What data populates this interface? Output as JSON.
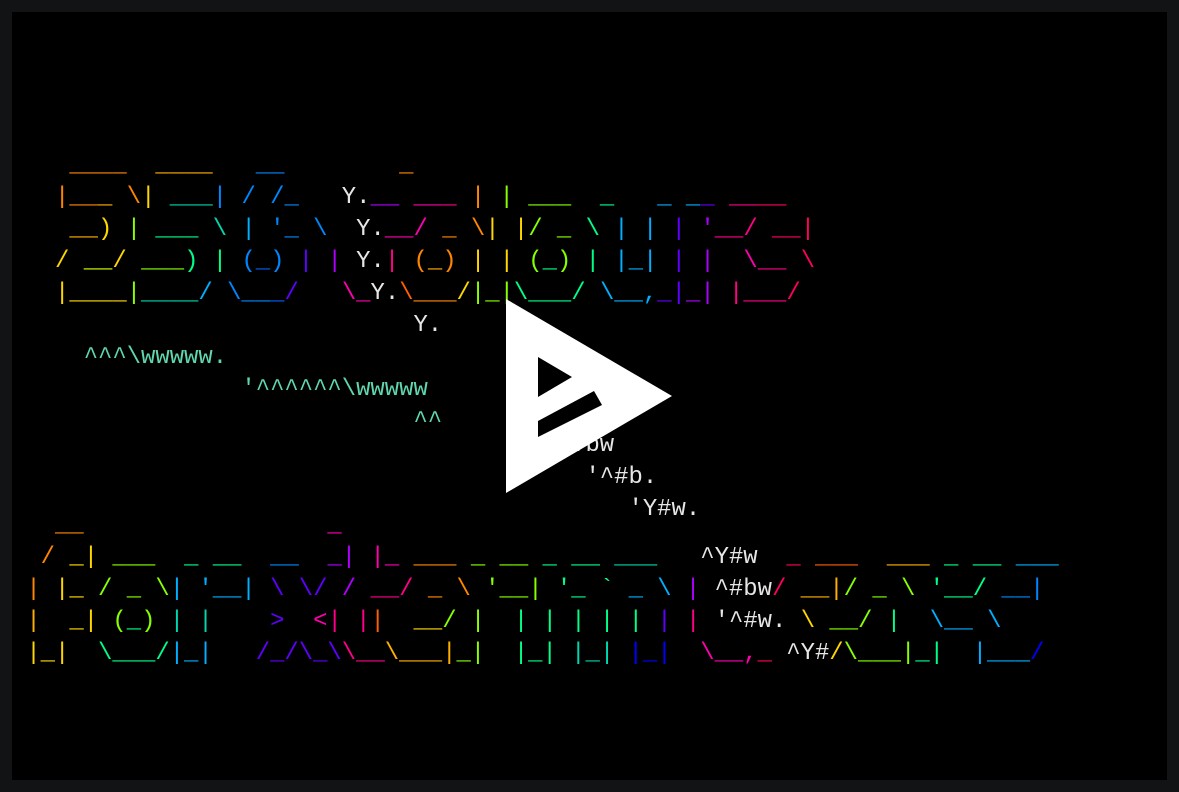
{
  "player": {
    "background": "#000000",
    "frame_color": "#121314",
    "play_button": {
      "icon": "play-icon",
      "label": "Play",
      "color": "#ffffff"
    }
  },
  "terminal": {
    "default_color": "#e6e6e6",
    "rows": [
      {
        "segs": [
          [
            "    ____",
            "#ff8700"
          ],
          [
            "  ",
            null
          ],
          [
            "____",
            "#ffaf00"
          ],
          [
            "   ",
            null
          ],
          [
            "__",
            "#0087ff"
          ],
          [
            "        ",
            null
          ],
          [
            "_",
            "#ff8700"
          ]
        ]
      },
      {
        "segs": [
          [
            "   |__",
            "#ff8700"
          ],
          [
            "_",
            "#ffaf00"
          ],
          [
            " \\",
            "#ff8700"
          ],
          [
            "| ",
            "#ffd700"
          ],
          [
            "___",
            "#00d7af"
          ],
          [
            "| / /_",
            "#0087ff"
          ],
          [
            "   Y.",
            "#e6e6e6"
          ],
          [
            "__",
            "#af00ff"
          ],
          [
            " __",
            "#ff00af"
          ],
          [
            "_",
            "#ff0087"
          ],
          [
            " | ",
            "#ff8700"
          ],
          [
            "| ___",
            "#87ff00"
          ],
          [
            "  _",
            "#00ff87"
          ],
          [
            "   _ _",
            "#00afff"
          ],
          [
            "_ ",
            "#5f00ff"
          ],
          [
            "__",
            "#ff0087"
          ],
          [
            "__",
            "#ff005f"
          ]
        ]
      },
      {
        "segs": [
          [
            "    __",
            "#ffaf00"
          ],
          [
            ") ",
            "#ffd700"
          ],
          [
            "| ",
            "#87ff00"
          ],
          [
            "___",
            "#00ff87"
          ],
          [
            " \\",
            "#00d7af"
          ],
          [
            " |",
            "#00afff"
          ],
          [
            " '_ \\",
            "#0087ff"
          ],
          [
            "  Y.",
            "#e6e6e6"
          ],
          [
            "__/ ",
            "#ff00af"
          ],
          [
            "_ \\",
            "#ff8700"
          ],
          [
            "| |",
            "#ffd700"
          ],
          [
            "/ _ ",
            "#87ff00"
          ],
          [
            "\\",
            "#00ff87"
          ],
          [
            " | |",
            "#00afff"
          ],
          [
            " |",
            "#5f00ff"
          ],
          [
            " '",
            "#af00ff"
          ],
          [
            "__/",
            "#ff0087"
          ],
          [
            " __",
            "#ff005f"
          ],
          [
            "|",
            "#ff005f"
          ]
        ]
      },
      {
        "segs": [
          [
            "   / ",
            "#ffd700"
          ],
          [
            "__",
            "#d7ff00"
          ],
          [
            "/ ",
            "#ffd700"
          ],
          [
            "___",
            "#87ff00"
          ],
          [
            ") | ",
            "#00ff87"
          ],
          [
            "(",
            "#0087ff"
          ],
          [
            "_",
            "#005fff"
          ],
          [
            ")",
            "#0087ff"
          ],
          [
            " | ",
            "#5f00ff"
          ],
          [
            "|",
            "#af00ff"
          ],
          [
            " Y.",
            "#e6e6e6"
          ],
          [
            "| ",
            "#ff0087"
          ],
          [
            "(",
            "#ff8700"
          ],
          [
            "_",
            "#ffaf00"
          ],
          [
            ")",
            "#ff8700"
          ],
          [
            " | | ",
            "#ffd700"
          ],
          [
            "(",
            "#87ff00"
          ],
          [
            "_",
            "#00ff87"
          ],
          [
            ")",
            "#87ff00"
          ],
          [
            " | ",
            "#00ff87"
          ],
          [
            "|_| ",
            "#00afff"
          ],
          [
            "| ",
            "#5f00ff"
          ],
          [
            "|",
            "#af00ff"
          ],
          [
            "  \\",
            "#ff00af"
          ],
          [
            "__",
            "#ff0087"
          ],
          [
            " \\",
            "#ff005f"
          ]
        ]
      },
      {
        "segs": [
          [
            "   |____",
            "#ffd700"
          ],
          [
            "|",
            "#87ff00"
          ],
          [
            "____",
            "#00d7af"
          ],
          [
            "/ ",
            "#00afff"
          ],
          [
            "\\__",
            "#0087ff"
          ],
          [
            "_",
            "#005fff"
          ],
          [
            "/   ",
            "#5f00ff"
          ],
          [
            "\\_",
            "#ff00af"
          ],
          [
            "Y.",
            "#e6e6e6"
          ],
          [
            "\\",
            "#ff5f00"
          ],
          [
            "___",
            "#ff8700"
          ],
          [
            "/",
            "#ffd700"
          ],
          [
            "|_|",
            "#87ff00"
          ],
          [
            "\\___/ ",
            "#00ff87"
          ],
          [
            "\\__,",
            "#00afff"
          ],
          [
            "_|",
            "#5f00ff"
          ],
          [
            "_|",
            "#af00ff"
          ],
          [
            " |___",
            "#ff0087"
          ],
          [
            "/",
            "#ff005f"
          ]
        ]
      },
      {
        "segs": [
          [
            "                            ",
            null
          ],
          [
            "Y.",
            "#e6e6e6"
          ]
        ]
      },
      {
        "segs": [
          [
            "     ",
            null
          ],
          [
            "^^^\\wwwww.",
            "#5fd7af"
          ]
        ]
      },
      {
        "segs": [
          [
            "                ",
            null
          ],
          [
            "'^^^^^^\\wwww",
            "#5fd7af"
          ],
          [
            "w",
            "#5fd7af"
          ]
        ]
      },
      {
        "segs": [
          [
            "                            ",
            null
          ],
          [
            "^^",
            "#5fd7af"
          ],
          [
            "      ",
            null
          ],
          [
            ".",
            "#e6e6e6"
          ]
        ]
      },
      {
        "segs": [
          [
            "                                      ",
            null
          ],
          [
            "^Ybw",
            "#e6e6e6"
          ]
        ]
      },
      {
        "segs": [
          [
            "                                        ",
            null
          ],
          [
            "'^#b.",
            "#e6e6e6"
          ]
        ]
      },
      {
        "segs": [
          [
            "                                           ",
            null
          ],
          [
            "'Y#w.",
            "#e6e6e6"
          ]
        ]
      },
      {
        "segs": [
          [
            "   __",
            "#ff8700"
          ],
          [
            "                 ",
            null
          ],
          [
            "_",
            "#ff00af"
          ]
        ]
      },
      {
        "segs": [
          [
            "  / ",
            "#ff8700"
          ],
          [
            "_|",
            "#ffd700"
          ],
          [
            " ___",
            "#87ff00"
          ],
          [
            "  _ __",
            "#00ff87"
          ],
          [
            "  __",
            "#0087ff"
          ],
          [
            "  _|",
            "#af00ff"
          ],
          [
            " |_",
            "#ff00af"
          ],
          [
            " ___",
            "#ff8700"
          ],
          [
            " _ __",
            "#87ff00"
          ],
          [
            " _ __",
            "#00ff87"
          ],
          [
            " ___",
            "#00d7af"
          ],
          [
            "   ",
            null
          ],
          [
            "^Y#w",
            "#e6e6e6"
          ],
          [
            "  _",
            "#ff005f"
          ],
          [
            " __",
            "#ff5f00"
          ],
          [
            "_",
            "#ff5f00"
          ],
          [
            "  ___",
            "#ffaf00"
          ],
          [
            " _ __",
            "#00ff87"
          ],
          [
            " ___",
            "#00afff"
          ]
        ]
      },
      {
        "segs": [
          [
            " | ",
            "#ff8700"
          ],
          [
            "|_",
            "#ffd700"
          ],
          [
            " / _ \\",
            "#87ff00"
          ],
          [
            "| '__|",
            "#00afff"
          ],
          [
            " \\ \\/",
            "#5f00ff"
          ],
          [
            " / ",
            "#af00ff"
          ],
          [
            "__/",
            "#ff0087"
          ],
          [
            " _ \\",
            "#ff8700"
          ],
          [
            " '__|",
            "#87ff00"
          ],
          [
            " '_ ` ",
            "#00ff87"
          ],
          [
            "_ \\",
            "#00afff"
          ],
          [
            " | ",
            "#af00ff"
          ],
          [
            "^#bw",
            "#e6e6e6"
          ],
          [
            "/",
            "#ff005f"
          ],
          [
            " __|",
            "#ffaf00"
          ],
          [
            "/ _ \\",
            "#87ff00"
          ],
          [
            " '__/",
            "#00ff87"
          ],
          [
            " __|",
            "#0087ff"
          ]
        ]
      },
      {
        "segs": [
          [
            " |  ",
            "#ffaf00"
          ],
          [
            "_|",
            "#ffd700"
          ],
          [
            " (",
            "#87ff00"
          ],
          [
            "_",
            "#00ff87"
          ],
          [
            ")",
            "#87ff00"
          ],
          [
            " | |",
            "#00d7af"
          ],
          [
            "    ",
            null
          ],
          [
            ">",
            "#5f00ff"
          ],
          [
            "  <",
            "#ff00af"
          ],
          [
            "| |",
            "#ff0087"
          ],
          [
            "|",
            "#ff5f00"
          ],
          [
            "  __",
            "#ffd700"
          ],
          [
            "/ |",
            "#87ff00"
          ],
          [
            "  | | | | |",
            "#00ff87"
          ],
          [
            " |",
            "#5f00ff"
          ],
          [
            " |",
            "#ff0087"
          ],
          [
            " '^#w.",
            "#e6e6e6"
          ],
          [
            " \\",
            "#ffd700"
          ],
          [
            " __/",
            "#87ff00"
          ],
          [
            " |  ",
            "#00ff87"
          ],
          [
            "\\__ \\",
            "#00afff"
          ]
        ]
      },
      {
        "segs": [
          [
            " |_|",
            "#ffd700"
          ],
          [
            "  \\___/",
            "#00ff87"
          ],
          [
            "|_|",
            "#00afff"
          ],
          [
            "   /_/\\_\\",
            "#5f00ff"
          ],
          [
            "\\__",
            "#ff0087"
          ],
          [
            "\\___|",
            "#ffaf00"
          ],
          [
            "_|",
            "#87ff00"
          ],
          [
            "  |_|",
            "#00ff87"
          ],
          [
            " |_|",
            "#00d7af"
          ],
          [
            " |_|",
            "#0000ff"
          ],
          [
            "  \\__,",
            "#ff00af"
          ],
          [
            "_",
            "#ff005f"
          ],
          [
            " ^Y#",
            "#e6e6e6"
          ],
          [
            "/",
            "#ffd700"
          ],
          [
            "\\___|",
            "#87ff00"
          ],
          [
            "_|",
            "#00ff87"
          ],
          [
            "  |___",
            "#00afff"
          ],
          [
            "/",
            "#0000ff"
          ]
        ]
      }
    ]
  }
}
